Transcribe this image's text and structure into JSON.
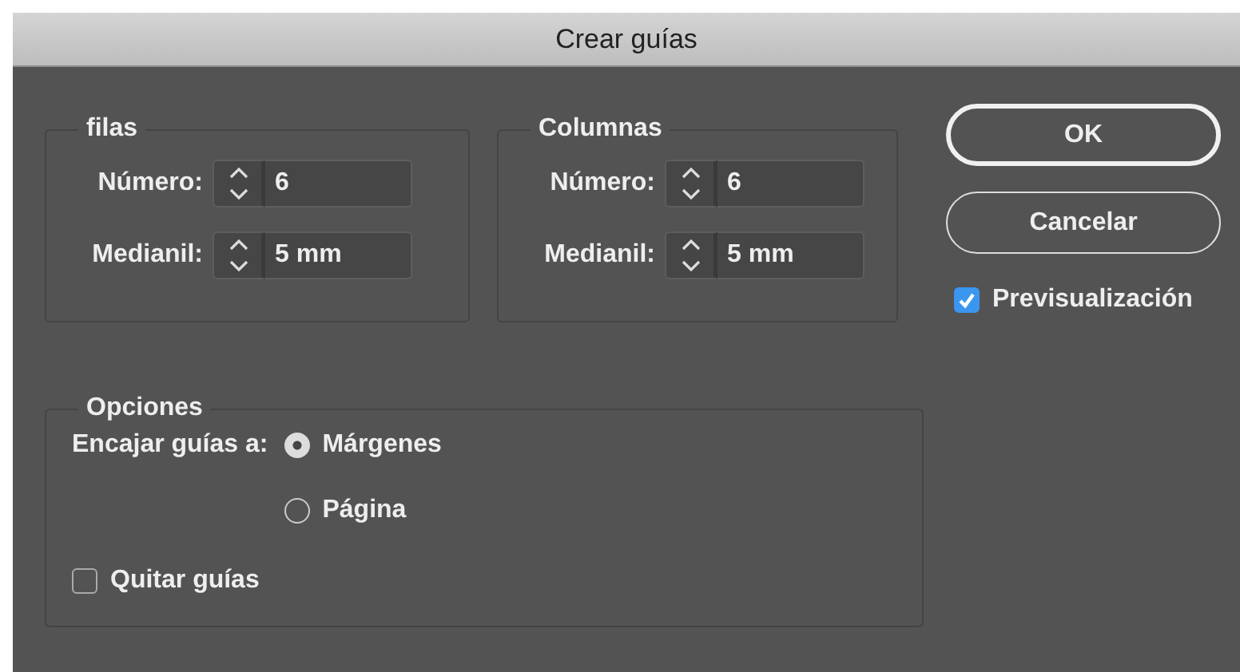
{
  "window": {
    "title": "Crear guías"
  },
  "groups": [
    {
      "title": "filas",
      "fields": [
        {
          "label": "Número:",
          "value": "6"
        },
        {
          "label": "Medianil:",
          "value": "5 mm"
        }
      ]
    },
    {
      "title": "Columnas",
      "fields": [
        {
          "label": "Número:",
          "value": "6"
        },
        {
          "label": "Medianil:",
          "value": "5 mm"
        }
      ]
    }
  ],
  "buttons": [
    {
      "label": "OK",
      "default": true
    },
    {
      "label": "Cancelar",
      "default": false
    }
  ],
  "preview": {
    "label": "Previsualización",
    "checked": true
  },
  "options": {
    "title": "Opciones",
    "snap_label": "Encajar guías a:",
    "radios": [
      {
        "label": "Márgenes",
        "selected": true
      },
      {
        "label": "Página",
        "selected": false
      }
    ],
    "remove_guides": {
      "label": "Quitar guías",
      "checked": false
    }
  }
}
